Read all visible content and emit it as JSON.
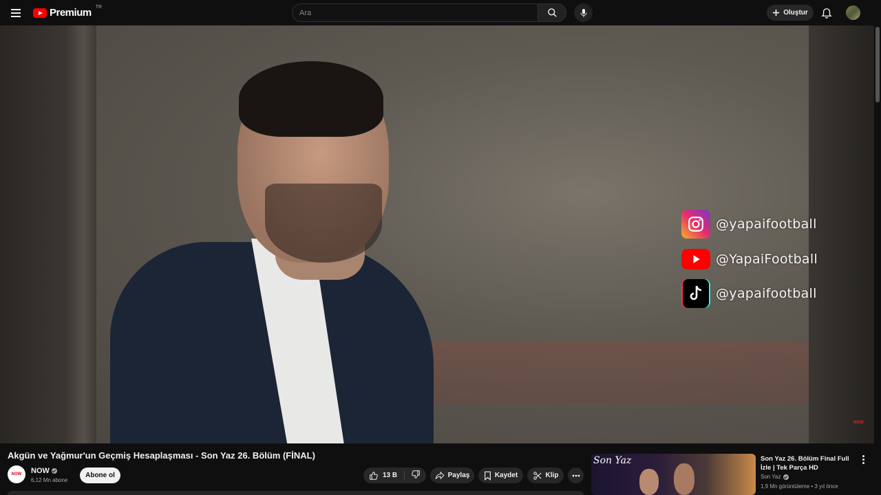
{
  "header": {
    "logo_text": "Premium",
    "country_code": "TR",
    "search_placeholder": "Ara",
    "create_label": "Oluştur"
  },
  "video": {
    "overlay_handles": [
      "@yapaifootball",
      "@YapaiFootball",
      "@yapaifootball"
    ],
    "watermark": "NOW",
    "title": "Akgün ve Yağmur'un Geçmiş Hesaplaşması - Son Yaz 26. Bölüm (FİNAL)"
  },
  "channel": {
    "logo_text": "NOW",
    "name": "NOW",
    "subscribers": "6,12 Mn abone",
    "subscribe_label": "Abone ol"
  },
  "actions": {
    "likes": "13 B",
    "share_label": "Paylaş",
    "save_label": "Kaydet",
    "clip_label": "Klip"
  },
  "recommendation": {
    "thumb_text": "Son Yaz",
    "title": "Son Yaz 26. Bölüm Final Full İzle | Tek Parça HD",
    "channel": "Son Yaz",
    "meta": "1,9 Mn görüntüleme • 3 yıl önce"
  },
  "colors": {
    "background": "#0f0f0f",
    "brand_red": "#ff0000",
    "button_bg": "#272727"
  }
}
